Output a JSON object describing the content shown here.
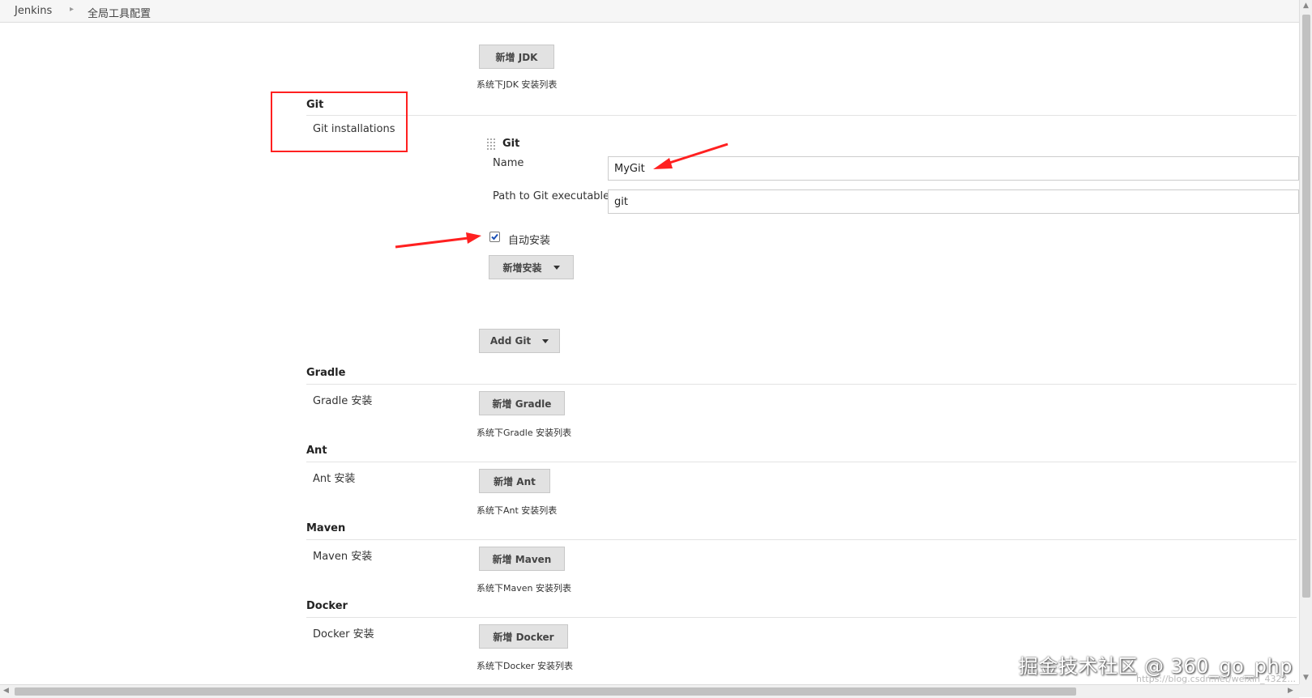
{
  "breadcrumb": {
    "home": "Jenkins",
    "current": "全局工具配置"
  },
  "jdk": {
    "add_button": "新增 JDK",
    "hint": "系统下JDK 安装列表"
  },
  "git": {
    "section_title": "Git",
    "installations_label": "Git installations",
    "item_title": "Git",
    "name_label": "Name",
    "name_value": "MyGit",
    "path_label": "Path to Git executable",
    "path_value": "git",
    "auto_install_label": "自动安装",
    "auto_install_checked": true,
    "add_installer_button": "新增安装",
    "add_git_button": "Add Git"
  },
  "gradle": {
    "section_title": "Gradle",
    "label": "Gradle 安装",
    "add_button": "新增 Gradle",
    "hint": "系统下Gradle 安装列表"
  },
  "ant": {
    "section_title": "Ant",
    "label": "Ant 安装",
    "add_button": "新增 Ant",
    "hint": "系统下Ant 安装列表"
  },
  "maven": {
    "section_title": "Maven",
    "label": "Maven 安装",
    "add_button": "新增 Maven",
    "hint": "系统下Maven 安装列表"
  },
  "docker": {
    "section_title": "Docker",
    "label": "Docker 安装",
    "add_button": "新增 Docker",
    "hint": "系统下Docker 安装列表"
  },
  "watermark": {
    "text": "掘金技术社区 @ 360_go_php",
    "url": "https://blog.csdn.net/weixin_4322..."
  },
  "colors": {
    "annotation_red": "#ff2020",
    "button_bg": "#e2e2e2"
  }
}
